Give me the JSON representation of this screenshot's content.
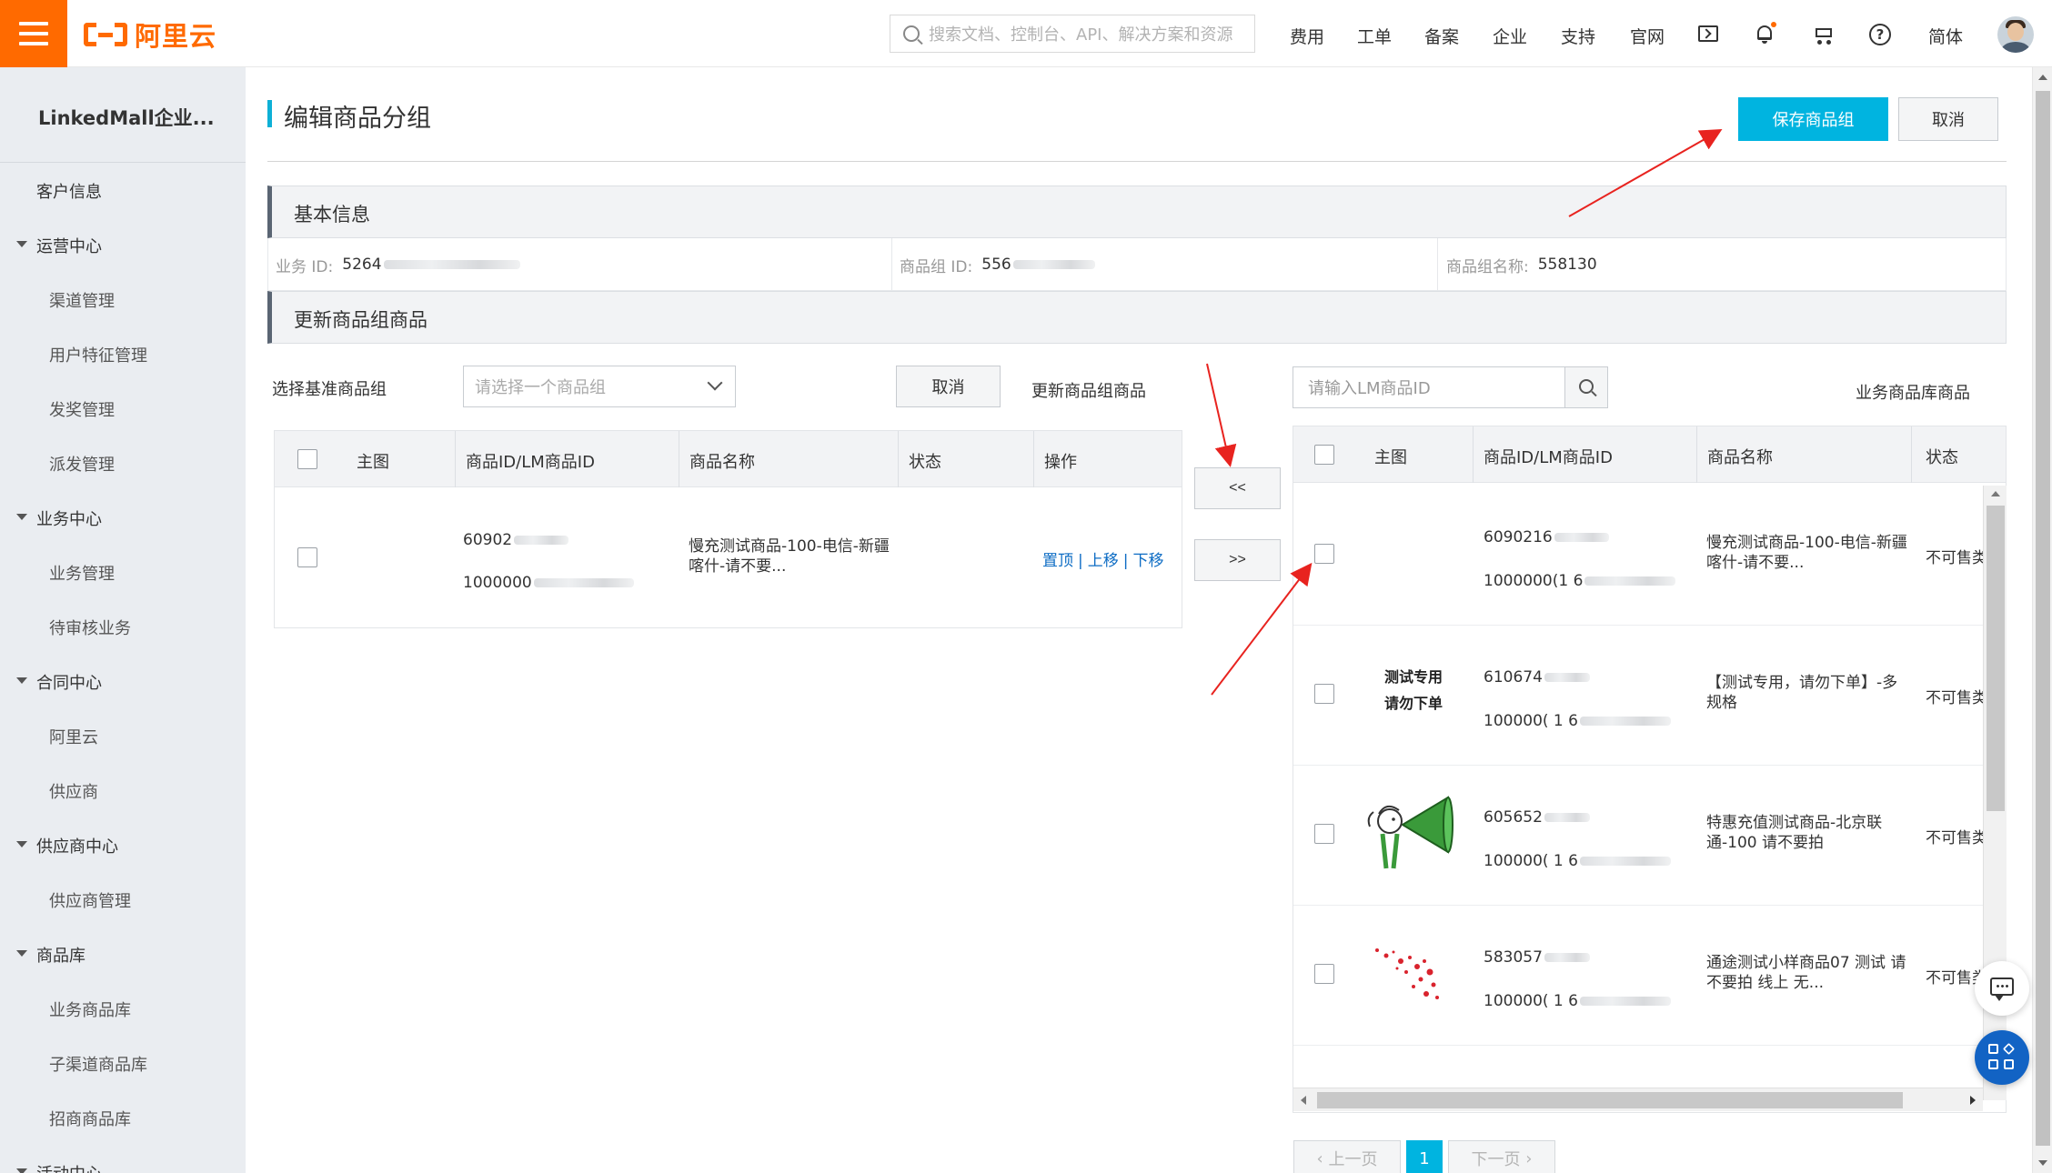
{
  "header": {
    "logo_text": "阿里云",
    "search_placeholder": "搜索文档、控制台、API、解决方案和资源",
    "nav": [
      "费用",
      "工单",
      "备案",
      "企业",
      "支持",
      "官网"
    ],
    "lang": "简体",
    "icons": [
      "menu-icon",
      "terminal-icon",
      "bell-icon",
      "cart-icon",
      "help-icon",
      "avatar"
    ],
    "accent": "#ff6a00"
  },
  "sidebar": {
    "title": "LinkedMall企业...",
    "items": [
      {
        "label": "客户信息",
        "level": "top"
      },
      {
        "label": "运营中心",
        "level": "group"
      },
      {
        "label": "渠道管理",
        "level": "sub"
      },
      {
        "label": "用户特征管理",
        "level": "sub"
      },
      {
        "label": "发奖管理",
        "level": "sub"
      },
      {
        "label": "派发管理",
        "level": "sub"
      },
      {
        "label": "业务中心",
        "level": "group"
      },
      {
        "label": "业务管理",
        "level": "sub"
      },
      {
        "label": "待审核业务",
        "level": "sub"
      },
      {
        "label": "合同中心",
        "level": "group"
      },
      {
        "label": "阿里云",
        "level": "sub"
      },
      {
        "label": "供应商",
        "level": "sub"
      },
      {
        "label": "供应商中心",
        "level": "group"
      },
      {
        "label": "供应商管理",
        "level": "sub"
      },
      {
        "label": "商品库",
        "level": "group"
      },
      {
        "label": "业务商品库",
        "level": "sub"
      },
      {
        "label": "子渠道商品库",
        "level": "sub"
      },
      {
        "label": "招商商品库",
        "level": "sub"
      },
      {
        "label": "活动中心",
        "level": "group"
      }
    ]
  },
  "main": {
    "title": "编辑商品分组",
    "save_button": "保存商品组",
    "cancel_button": "取消",
    "basic_info": {
      "section_title": "基本信息",
      "business_id_label": "业务 ID:",
      "business_id_value": "5264",
      "group_id_label": "商品组 ID:",
      "group_id_value": "556",
      "group_name_label": "商品组名称:",
      "group_name_value": "558130"
    },
    "update_section": {
      "section_title": "更新商品组商品",
      "select_base_label": "选择基准商品组",
      "select_placeholder": "请选择一个商品组",
      "cancel_label": "取消",
      "left_caption": "更新商品组商品",
      "move_left": "<<",
      "move_right": ">>",
      "search_placeholder": "请输入LM商品ID",
      "right_caption": "业务商品库商品"
    },
    "left_table": {
      "columns": [
        "主图",
        "商品ID/LM商品ID",
        "商品名称",
        "状态",
        "操作"
      ],
      "rows": [
        {
          "id": "60902",
          "lm_id": "1000000",
          "name": "慢充测试商品-100-电信-新疆喀什-请不要...",
          "status": "",
          "ops": [
            "置顶",
            "上移",
            "下移"
          ]
        }
      ]
    },
    "right_table": {
      "columns": [
        "主图",
        "商品ID/LM商品ID",
        "商品名称",
        "状态"
      ],
      "rows": [
        {
          "image": "",
          "id": "6090216",
          "lm_id": "1000000(1 6",
          "name": "慢充测试商品-100-电信-新疆喀什-请不要...",
          "status": "不可售类"
        },
        {
          "image": "测试专用 请勿下单",
          "id": "610674",
          "lm_id": "100000( 1 6",
          "name": "【测试专用，请勿下单】-多规格",
          "status": "不可售类"
        },
        {
          "image": "megaphone-figure",
          "id": "605652",
          "lm_id": "100000( 1 6",
          "name": "特惠充值测试商品-北京联通-100 请不要拍",
          "status": "不可售类"
        },
        {
          "image": "red-petals",
          "id": "583057",
          "lm_id": "100000( 1 6",
          "name": "通途测试小样商品07 测试 请不要拍 线上 无...",
          "status": "不可售类"
        }
      ]
    },
    "pagination": {
      "prev": "上一页",
      "current": "1",
      "next": "下一页"
    }
  },
  "colors": {
    "primary_button": "#00b4e0",
    "link": "#0d6cc4",
    "annotation_arrow": "#e8231f",
    "brand": "#ff6a00"
  }
}
